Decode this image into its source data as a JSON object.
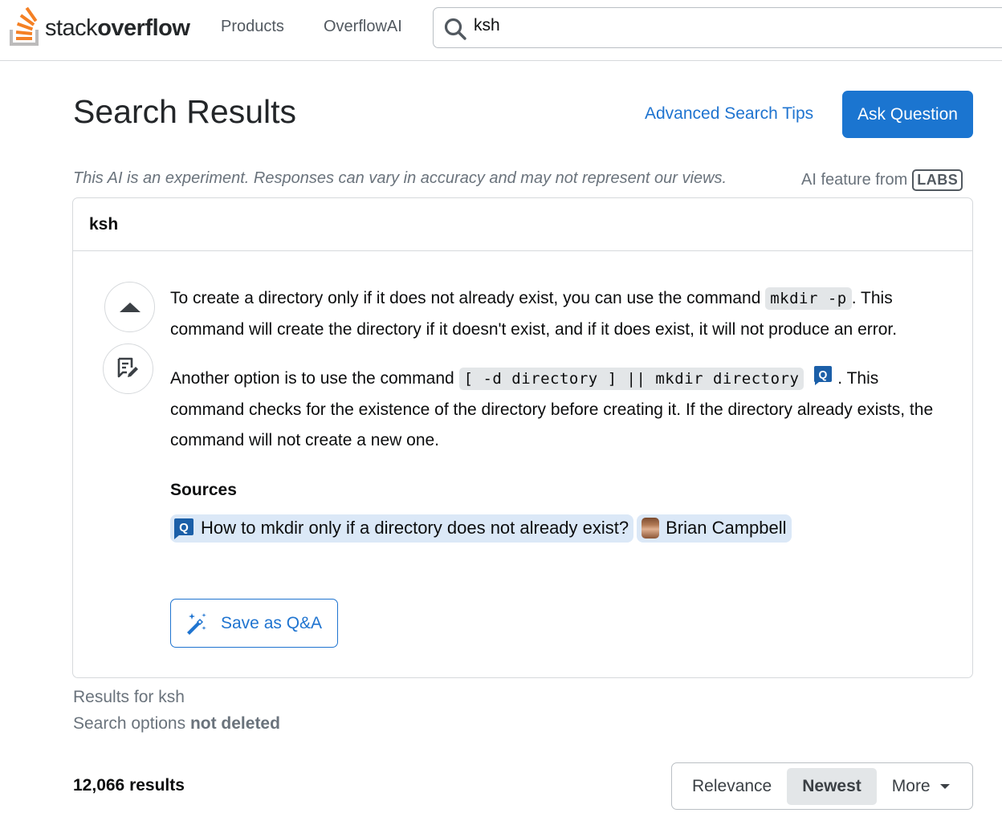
{
  "topbar": {
    "logo_text_light": "stack",
    "logo_text_bold": "overflow",
    "nav": [
      {
        "label": "Products"
      },
      {
        "label": "OverflowAI"
      }
    ],
    "search": {
      "value": "ksh",
      "icon": "search-icon"
    }
  },
  "header": {
    "title": "Search Results",
    "advanced_tips": "Advanced Search Tips",
    "ask_question": "Ask Question"
  },
  "ai": {
    "disclaimer": "This AI is an experiment. Responses can vary in accuracy and may not represent our views.",
    "feature_from": "AI feature from",
    "labs_badge": "LABS",
    "query": "ksh",
    "paragraph1": {
      "before": "To create a directory only if it does not already exist, you can use the command",
      "code": "mkdir -p",
      "after": ". This command will create the directory if it doesn't exist, and if it does exist, it will not produce an error."
    },
    "paragraph2": {
      "before": "Another option is to use the command",
      "code": "[ -d directory ] || mkdir directory",
      "after": ". This command checks for the existence of the directory before creating it. If the directory already exists, the command will not create a new one."
    },
    "sources_title": "Sources",
    "sources": [
      {
        "type": "question",
        "label": "How to mkdir only if a directory does not already exist?"
      },
      {
        "type": "user",
        "label": "Brian Campbell"
      }
    ],
    "save_button": "Save as Q&A"
  },
  "results": {
    "results_for": "Results for ksh",
    "search_options_label": "Search options",
    "search_options_value": "not deleted",
    "count": "12,066 results",
    "sort": {
      "options": [
        {
          "label": "Relevance",
          "active": false
        },
        {
          "label": "Newest",
          "active": true
        },
        {
          "label": "More",
          "active": false
        }
      ]
    }
  },
  "colors": {
    "accent": "#1b75d0",
    "link": "#1f74d0",
    "logo_orange": "#f48024",
    "chip_bg": "#dbe8f7",
    "code_bg": "#e3e6e8"
  }
}
